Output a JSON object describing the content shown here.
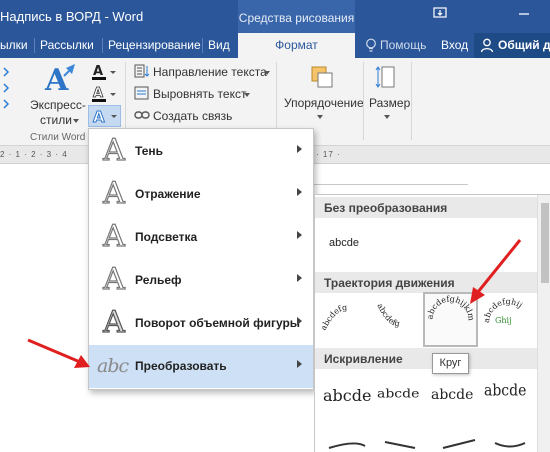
{
  "window": {
    "title": "Надпись в ВОРД - Word",
    "context_tab": "Средства рисования",
    "controls": [
      "restore-icon",
      "minimize-icon"
    ]
  },
  "tabs": {
    "items": [
      "ылки",
      "Рассылки",
      "Рецензирование",
      "Вид"
    ],
    "active": "Формат",
    "help": "Помощь",
    "login": "Вход",
    "share": "Общий д"
  },
  "ribbon": {
    "express_line1": "Экспресс-",
    "express_line2": "стили",
    "styles_group": "Стили Word",
    "text_direction": "Направление текста",
    "align_text": "Выровнять текст",
    "create_link": "Создать связь",
    "arrange": "Упорядочение",
    "size": "Размер"
  },
  "ruler": {
    "left_marks": "2 · 1 · 2 · 3 · 4",
    "right_marks": "· 17 ·"
  },
  "menu": {
    "items": [
      {
        "icon": "A",
        "label": "Тень"
      },
      {
        "icon": "A",
        "label": "Отражение"
      },
      {
        "icon": "A",
        "label": "Подсветка"
      },
      {
        "icon": "A",
        "label": "Рельеф"
      },
      {
        "icon": "A",
        "label": "Поворот объемной фигуры"
      },
      {
        "icon": "abc",
        "label": "Преобразовать"
      }
    ]
  },
  "gallery": {
    "section_none": "Без преобразования",
    "plain_sample": "abcde",
    "section_path": "Траектория движения",
    "path_samples": [
      "abcdefg",
      "abcdefghijklm",
      "abcdefghij"
    ],
    "section_warp": "Искривление",
    "warp_samples": [
      "abcde",
      "abcde",
      "abcde",
      "abcde"
    ],
    "tooltip": "Круг"
  },
  "colors": {
    "word_blue": "#2b579a",
    "highlight": "#cde0f6",
    "arrow_red": "#e02020"
  }
}
